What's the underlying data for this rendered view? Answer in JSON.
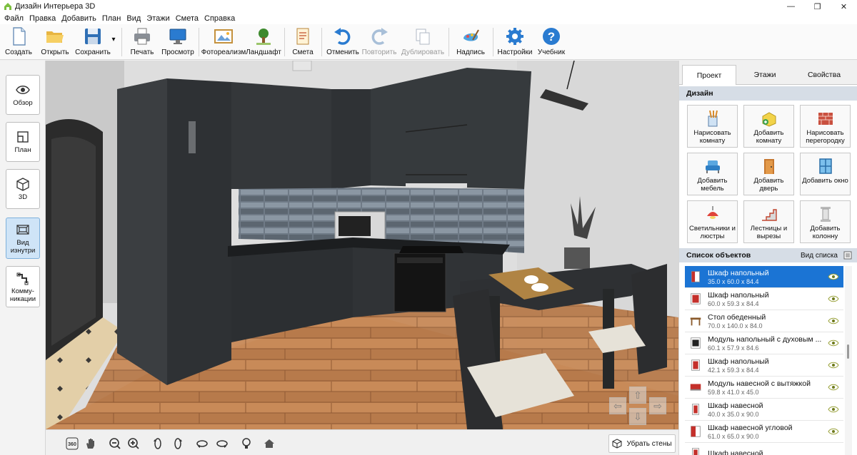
{
  "window": {
    "title": "Дизайн Интерьера 3D",
    "min": "—",
    "max": "❐",
    "close": "✕"
  },
  "menu": [
    "Файл",
    "Правка",
    "Добавить",
    "План",
    "Вид",
    "Этажи",
    "Смета",
    "Справка"
  ],
  "toolbar": {
    "create": "Создать",
    "open": "Открыть",
    "save": "Сохранить",
    "save_arrow": "▾",
    "print": "Печать",
    "preview": "Просмотр",
    "photoreal": "Фотореализм",
    "landscape": "Ландшафт",
    "estimate": "Смета",
    "undo": "Отменить",
    "redo": "Повторить",
    "duplicate": "Дублировать",
    "label": "Надпись",
    "settings": "Настройки",
    "tutorial": "Учебник"
  },
  "sidebar": {
    "overview": "Обзор",
    "plan": "План",
    "view3d": "3D",
    "inside": "Вид изнутри",
    "utilities": "Комму-никации"
  },
  "bottombar": {
    "rotate360": "360",
    "remove_walls": "Убрать стены"
  },
  "rightpanel": {
    "tabs": [
      "Проект",
      "Этажи",
      "Свойства"
    ],
    "active_tab": "Проект",
    "design_header": "Дизайн",
    "design_buttons": [
      "Нарисовать комнату",
      "Добавить комнату",
      "Нарисовать перегородку",
      "Добавить мебель",
      "Добавить дверь",
      "Добавить окно",
      "Светильники и люстры",
      "Лестницы и вырезы",
      "Добавить колонну"
    ],
    "objects_header": "Список объектов",
    "list_view": "Вид списка",
    "objects": [
      {
        "name": "Шкаф напольный",
        "dims": "35.0 x 60.0 x 84.4",
        "selected": true
      },
      {
        "name": "Шкаф напольный",
        "dims": "60.0 x 59.3 x 84.4",
        "selected": false
      },
      {
        "name": "Стол обеденный",
        "dims": "70.0 x 140.0 x 84.0",
        "selected": false
      },
      {
        "name": "Модуль напольный с духовым ...",
        "dims": "60.1 x 57.9 x 84.6",
        "selected": false
      },
      {
        "name": "Шкаф напольный",
        "dims": "42.1 x 59.3 x 84.4",
        "selected": false
      },
      {
        "name": "Модуль навесной с вытяжкой",
        "dims": "59.8 x 41.0 x 45.0",
        "selected": false
      },
      {
        "name": "Шкаф навесной",
        "dims": "40.0 x 35.0 x 90.0",
        "selected": false
      },
      {
        "name": "Шкаф навесной угловой",
        "dims": "61.0 x 65.0 x 90.0",
        "selected": false
      },
      {
        "name": "Шкаф навесной",
        "dims": "",
        "selected": false
      }
    ]
  },
  "colors": {
    "accent": "#1b74d4",
    "header": "#d6dde6",
    "cabinet": "#3a3d40"
  }
}
